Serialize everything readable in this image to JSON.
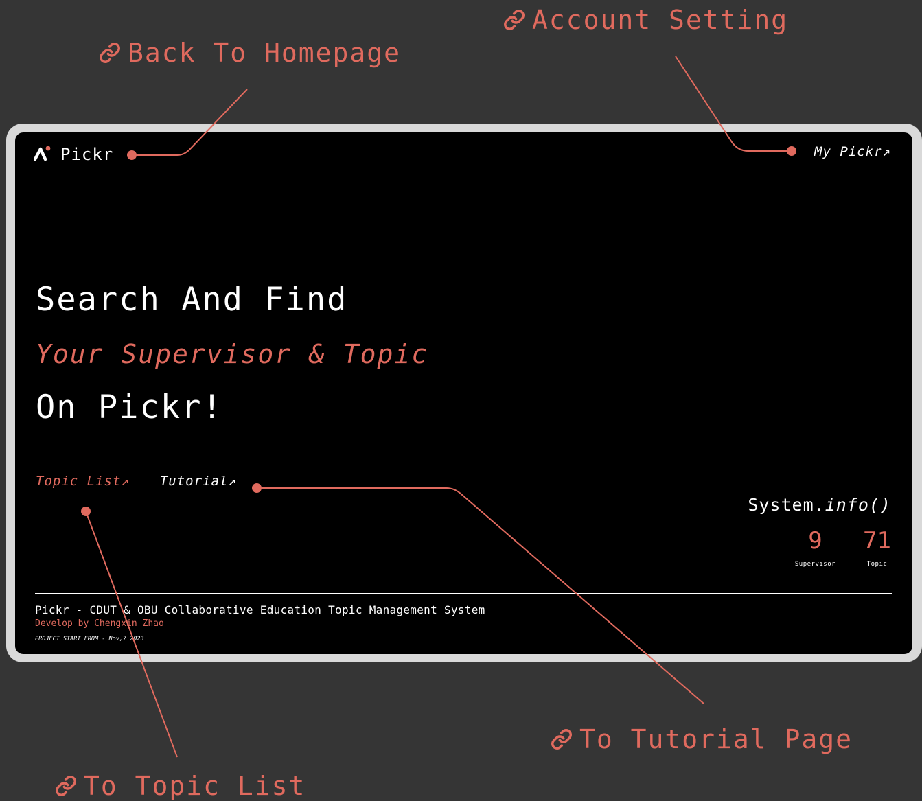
{
  "annotations": {
    "back_to_homepage": "Back To Homepage",
    "account_setting": "Account Setting",
    "to_tutorial_page": "To Tutorial Page",
    "to_topic_list": "To Topic List",
    "icon": "link-icon"
  },
  "header": {
    "brand_name": "Pickr",
    "logo_icon": "pickr-logo-icon",
    "my_pickr_label": "My Pickr↗"
  },
  "hero": {
    "line1": "Search And Find",
    "line2": "Your Supervisor & Topic",
    "line3": "On Pickr!"
  },
  "links": {
    "topic_list": "Topic List↗",
    "tutorial": "Tutorial↗"
  },
  "system_info": {
    "title_prefix": "System.",
    "title_fn": "info()",
    "stats": [
      {
        "value": "9",
        "label": "Supervisor"
      },
      {
        "value": "71",
        "label": "Topic"
      }
    ]
  },
  "footer": {
    "title": "Pickr - CDUT & OBU Collaborative Education Topic Management System",
    "developer": "Develop by Chengxin Zhao",
    "project_start": "PROJECT START FROM - Nov,7 2023"
  },
  "colors": {
    "accent": "#e06a5e",
    "page_background": "#353535",
    "frame": "#d9d9d9",
    "screen_background": "#000000",
    "text": "#ffffff"
  }
}
